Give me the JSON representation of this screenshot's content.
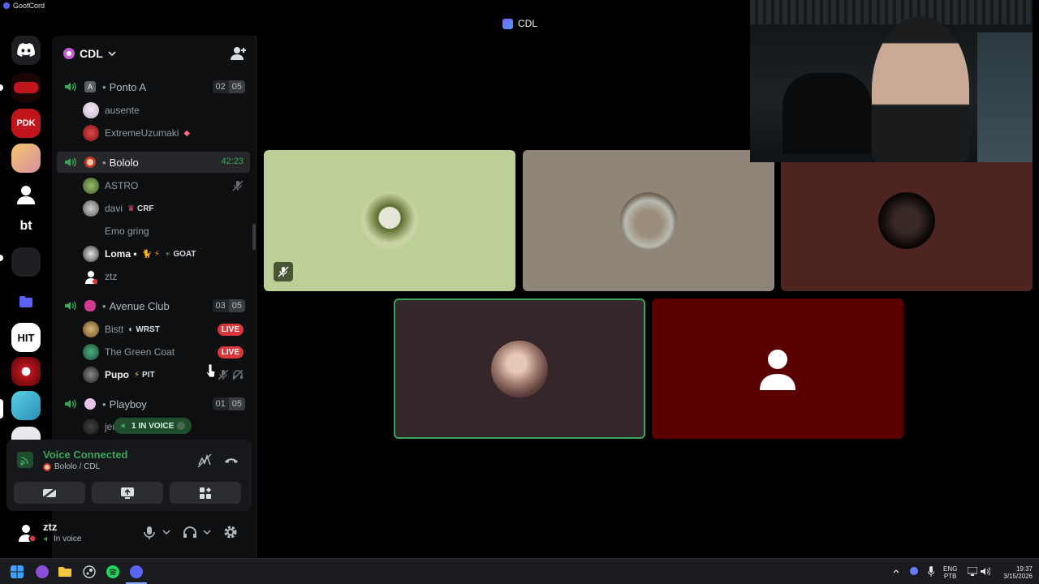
{
  "app": {
    "title": "GoofCord",
    "window_title": "CDL"
  },
  "rail": {
    "servers": [
      {
        "name": "home",
        "label": ""
      },
      {
        "name": "server-red-car",
        "label": ""
      },
      {
        "name": "server-pdk",
        "label": "PDK"
      },
      {
        "name": "server-anime",
        "label": ""
      },
      {
        "name": "server-person",
        "label": ""
      },
      {
        "name": "server-bt",
        "label": "bt"
      },
      {
        "name": "server-folder-group",
        "label": ""
      },
      {
        "name": "server-folder",
        "label": ""
      },
      {
        "name": "server-hit",
        "label": "HIT"
      },
      {
        "name": "server-swirl",
        "label": ""
      },
      {
        "name": "server-cyan",
        "label": ""
      },
      {
        "name": "server-cdl",
        "label": ""
      }
    ]
  },
  "guild": {
    "name": "CDL"
  },
  "channels": [
    {
      "name": "Ponto A",
      "users": "02",
      "limit": "05",
      "members": [
        {
          "name": "ausente",
          "badge": ""
        },
        {
          "name": "ExtremeUzumaki",
          "badge": ""
        }
      ]
    },
    {
      "name": "Bololo",
      "timer": "42:23",
      "members": [
        {
          "name": "ASTRO",
          "badge": ""
        },
        {
          "name": "davi",
          "badge": "CRF"
        },
        {
          "name": "Emo gring",
          "badge": ""
        },
        {
          "name": "Loma •",
          "badge": "GOAT"
        },
        {
          "name": "ztz",
          "badge": ""
        }
      ]
    },
    {
      "name": "Avenue Club",
      "users": "03",
      "limit": "05",
      "members": [
        {
          "name": "Bistt",
          "badge": "WRST",
          "live": "LIVE"
        },
        {
          "name": "The Green Coat",
          "badge": "",
          "live": "LIVE"
        },
        {
          "name": "Pupo",
          "badge": "PIT"
        }
      ]
    },
    {
      "name": "Playboy",
      "users": "01",
      "limit": "05",
      "members": [
        {
          "name": "jer",
          "badge": ""
        }
      ],
      "in_voice": "1 IN VOICE"
    }
  ],
  "voice": {
    "title": "Voice Connected",
    "location": "Bololo / CDL"
  },
  "user": {
    "name": "ztz",
    "status": "In voice"
  },
  "taskbar": {
    "lang": "ENG",
    "layout": "PTB",
    "time": "19:37",
    "date": "3/15/2026"
  },
  "colors": {
    "accent_green": "#3ba55c",
    "live_red": "#da373c",
    "blurple": "#5865f2"
  }
}
